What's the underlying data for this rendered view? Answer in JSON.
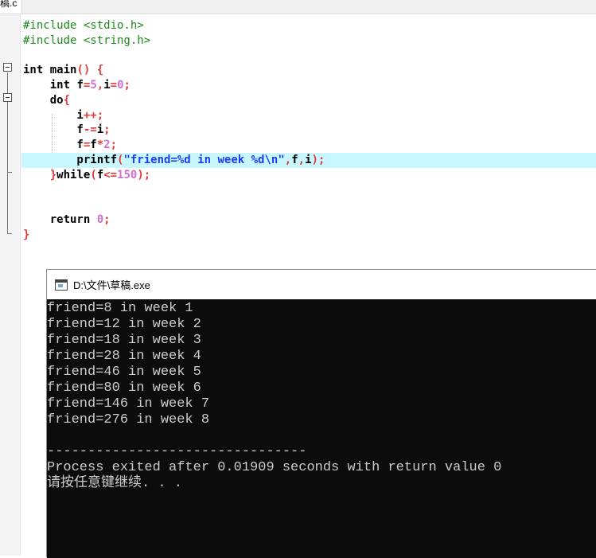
{
  "editor": {
    "tab_label": "稿.c",
    "lines": [
      {
        "pre": "#include <stdio.h>"
      },
      {
        "pre": "#include <string.h>"
      },
      {},
      {
        "parts": [
          "int",
          " main",
          "()",
          " {"
        ]
      },
      {
        "parts": [
          "    int",
          " f",
          "=",
          "5",
          ",",
          "i",
          "=",
          "0",
          ";"
        ]
      },
      {
        "parts": [
          "    do",
          "{"
        ]
      },
      {
        "parts": [
          "        i",
          "++;"
        ]
      },
      {
        "parts": [
          "        f",
          "-=",
          "i",
          ";"
        ]
      },
      {
        "parts": [
          "        f",
          "=",
          "f",
          "*",
          "2",
          ";"
        ]
      },
      {
        "parts": [
          "        printf",
          "(",
          "\"friend=%d in week %d\\n\"",
          ",",
          "f",
          ",",
          "i",
          ");"
        ]
      },
      {
        "parts": [
          "    ",
          "}",
          "while",
          "(",
          "f",
          "<=",
          "150",
          ");"
        ]
      },
      {},
      {},
      {
        "parts": [
          "    return",
          " ",
          "0",
          ";"
        ]
      },
      {
        "parts": [
          "}"
        ]
      }
    ]
  },
  "console": {
    "title": "D:\\文件\\草稿.exe",
    "output": [
      "friend=8 in week 1",
      "friend=12 in week 2",
      "friend=18 in week 3",
      "friend=28 in week 4",
      "friend=46 in week 5",
      "friend=80 in week 6",
      "friend=146 in week 7",
      "friend=276 in week 8",
      "",
      "--------------------------------",
      "Process exited after 0.01909 seconds with return value 0",
      "请按任意键继续. . ."
    ]
  }
}
